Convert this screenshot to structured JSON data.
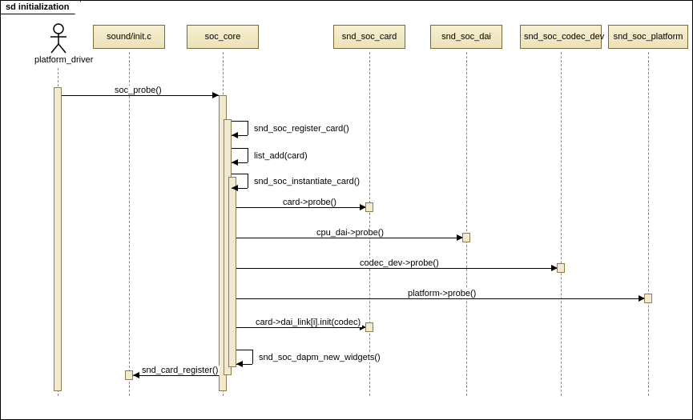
{
  "title": "sd initialization",
  "actor": {
    "label": "platform_driver"
  },
  "lifelines": [
    {
      "label": "sound/init.c"
    },
    {
      "label": "soc_core"
    },
    {
      "label": "snd_soc_card"
    },
    {
      "label": "snd_soc_dai"
    },
    {
      "label": "snd_soc_codec_dev"
    },
    {
      "label": "snd_soc_platform"
    }
  ],
  "messages": {
    "soc_probe": "soc_probe()",
    "reg_card": "snd_soc_register_card()",
    "list_add": "list_add(card)",
    "inst_card": "snd_soc_instantiate_card()",
    "card_probe": "card->probe()",
    "cpu_dai_probe": "cpu_dai->probe()",
    "codec_probe": "codec_dev->probe()",
    "platform_probe": "platform->probe()",
    "dai_link_init": "card->dai_link[i].init(codec)",
    "dapm_widgets": "snd_soc_dapm_new_widgets()",
    "card_register": "snd_card_register()"
  }
}
